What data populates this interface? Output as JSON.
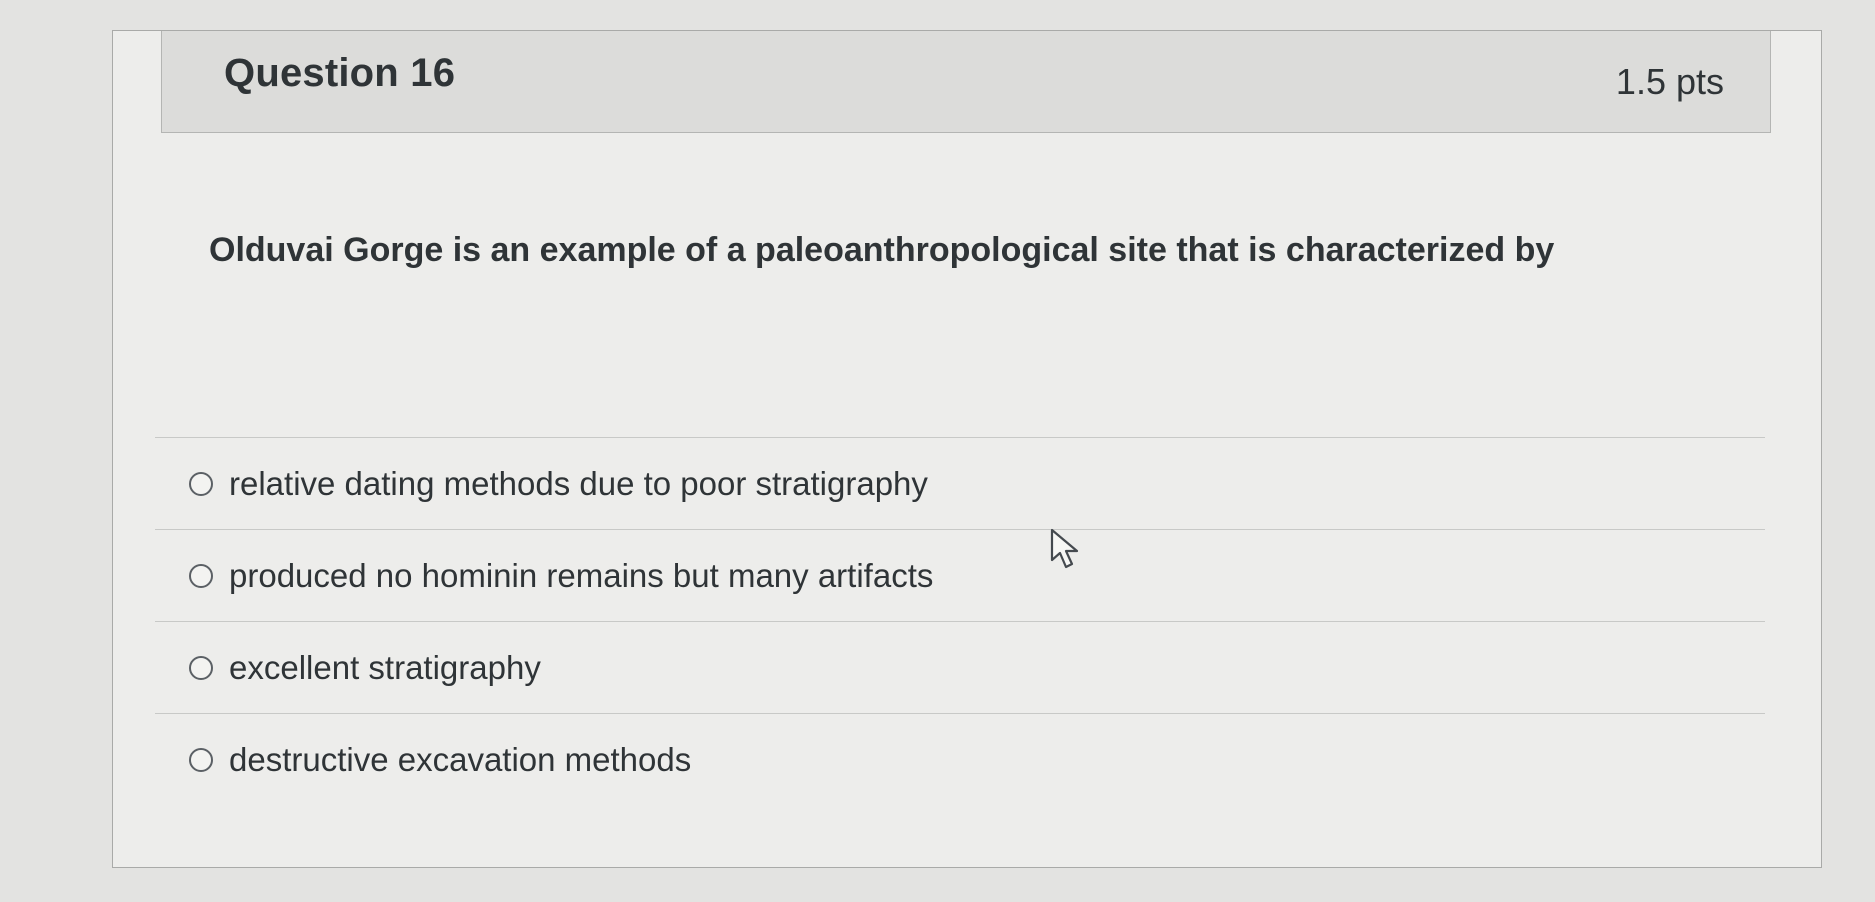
{
  "question": {
    "title": "Question 16",
    "points": "1.5 pts",
    "prompt": "Olduvai Gorge is an example of a paleoanthropological site that is characterized by"
  },
  "answers": [
    {
      "label": "relative dating methods due to poor stratigraphy",
      "selected": false
    },
    {
      "label": "produced no hominin remains but many artifacts",
      "selected": false
    },
    {
      "label": "excellent stratigraphy",
      "selected": false
    },
    {
      "label": "destructive excavation methods",
      "selected": false
    }
  ],
  "icons": {
    "radio": "radio-button-icon",
    "cursor": "mouse-pointer-icon"
  }
}
